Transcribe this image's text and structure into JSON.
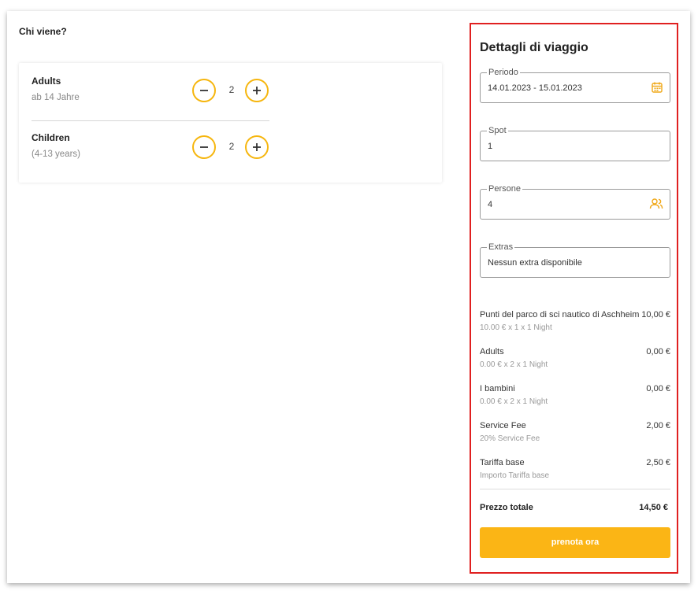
{
  "who": {
    "title": "Chi viene?",
    "adults": {
      "label": "Adults",
      "sub": "ab 14 Jahre",
      "count": "2"
    },
    "children": {
      "label": "Children",
      "sub": "(4-13 years)",
      "count": "2"
    }
  },
  "summary": {
    "title": "Dettagli di viaggio",
    "fields": {
      "period": {
        "legend": "Periodo",
        "value": "14.01.2023 - 15.01.2023",
        "icon": "calendar-icon"
      },
      "spot": {
        "legend": "Spot",
        "value": "1"
      },
      "persons": {
        "legend": "Persone",
        "value": "4",
        "icon": "people-icon"
      },
      "extras": {
        "legend": "Extras",
        "value": "Nessun extra disponibile"
      }
    },
    "prices": [
      {
        "name": "Punti del parco di sci nautico di Aschheim",
        "value": "10,00 €",
        "detail": "10.00 € x 1 x 1 Night"
      },
      {
        "name": "Adults",
        "value": "0,00 €",
        "detail": "0.00 € x 2 x 1 Night"
      },
      {
        "name": "I bambini",
        "value": "0,00 €",
        "detail": "0.00 € x 2 x 1 Night"
      },
      {
        "name": "Service Fee",
        "value": "2,00 €",
        "detail": "20% Service Fee"
      },
      {
        "name": "Tariffa base",
        "value": "2,50 €",
        "detail": "Importo Tariffa base"
      }
    ],
    "total": {
      "label": "Prezzo totale",
      "value": "14,50 €"
    },
    "book_label": "prenota ora"
  },
  "colors": {
    "accent": "#fbb515",
    "highlight_border": "#e02020"
  }
}
